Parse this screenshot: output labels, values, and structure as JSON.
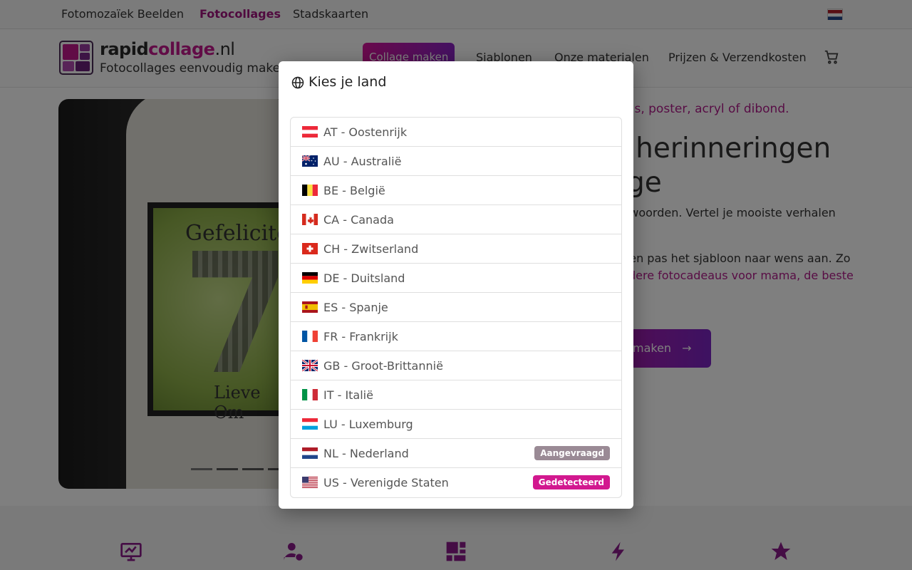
{
  "topbar": {
    "links": [
      "Fotomozaïek Beelden",
      "Fotocollages",
      "Stadskaarten"
    ]
  },
  "header": {
    "logo": {
      "name_part1": "rapid",
      "name_part2": "collage",
      "name_tld": ".nl",
      "tagline": "Fotocollages eenvoudig maken"
    },
    "cta": "Collage maken",
    "nav": [
      "Sjablonen",
      "Onze materialen",
      "Prijzen & Verzendkosten"
    ],
    "cart_icon": "cart-icon"
  },
  "hero": {
    "frame_text_top": "Gefelicite",
    "frame_text_bottom": "Lieve Om",
    "subtitle": "vas, poster, acryl of dibond.",
    "heading_line1": "n herinneringen",
    "heading_line2": "ge",
    "text1": "d woorden. Vertel je mooiste verhalen",
    "text2": "n en pas het sjabloon naar wens aan. Zo",
    "link": "dere fotocadeaus voor mama, de beste",
    "button": "maken"
  },
  "features": {
    "icons": [
      "monitor-icon",
      "user-check-icon",
      "layout-grid-icon",
      "bolt-icon",
      "star-icon"
    ]
  },
  "modal": {
    "title": "Kies je land",
    "icon": "globe-icon",
    "countries": [
      {
        "code": "AT",
        "label": "AT - Oostenrijk",
        "badge": ""
      },
      {
        "code": "AU",
        "label": "AU - Australië",
        "badge": ""
      },
      {
        "code": "BE",
        "label": "BE - België",
        "badge": ""
      },
      {
        "code": "CA",
        "label": "CA - Canada",
        "badge": ""
      },
      {
        "code": "CH",
        "label": "CH - Zwitserland",
        "badge": ""
      },
      {
        "code": "DE",
        "label": "DE - Duitsland",
        "badge": ""
      },
      {
        "code": "ES",
        "label": "ES - Spanje",
        "badge": ""
      },
      {
        "code": "FR",
        "label": "FR - Frankrijk",
        "badge": ""
      },
      {
        "code": "GB",
        "label": "GB - Groot-Brittannië",
        "badge": ""
      },
      {
        "code": "IT",
        "label": "IT - Italië",
        "badge": ""
      },
      {
        "code": "LU",
        "label": "LU - Luxemburg",
        "badge": ""
      },
      {
        "code": "NL",
        "label": "NL - Nederland",
        "badge": "Aangevraagd"
      },
      {
        "code": "US",
        "label": "US - Verenigde Staten",
        "badge": "Gedetecteerd"
      }
    ]
  },
  "colors": {
    "accent": "#c2188c",
    "badge_requested": "#9a8a95",
    "badge_detected": "#d2188f"
  }
}
